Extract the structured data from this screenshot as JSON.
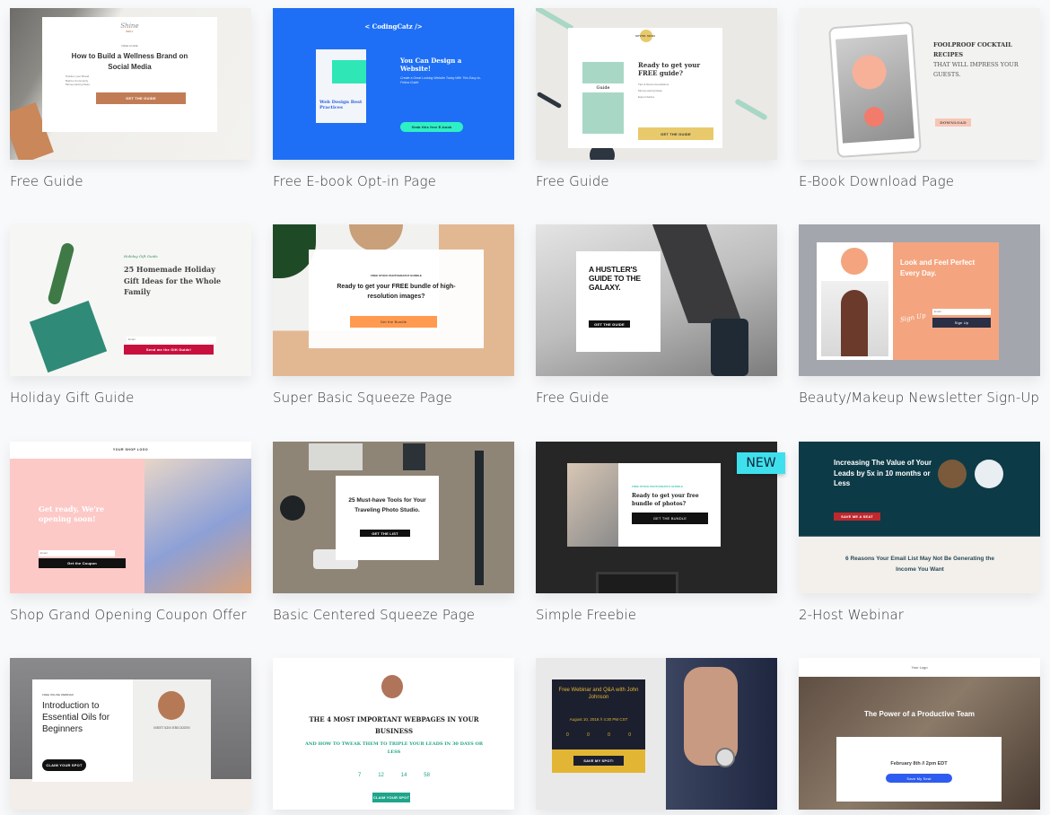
{
  "cards": [
    {
      "title": "Free Guide",
      "logo": "Shine",
      "logo2": "WELL",
      "kicker": "FREE GUIDE",
      "heading": "How to Build a Wellness Brand on Social Media",
      "bullets": [
        "Position your Brand",
        "Build a Community",
        "Money-saving Ideas"
      ],
      "button": "GET THE GUIDE"
    },
    {
      "title": "Free E-book Opt-in Page",
      "brand": "< CodingCatz />",
      "book": "Web Design Best Practices",
      "heading": "You Can Design a Website!",
      "sub": "Create a Great Looking Website Today With This Easy-to-Follow Guide",
      "button": "Grab this free E-book",
      "color": "#1e6ff5"
    },
    {
      "title": "Free Guide",
      "logo": "seven suns",
      "book": "Guide",
      "heading": "Ready to get your FREE guide?",
      "bullets": [
        "Tips & Recommendations",
        "Money-saving Ideas",
        "Expert Advice"
      ],
      "button": "GET THE GUIDE"
    },
    {
      "title": "E-Book Download Page",
      "heading": "FOOLPROOF COCKTAIL RECIPES",
      "heading2": "THAT WILL IMPRESS YOUR GUESTS.",
      "button": "DOWNLOAD"
    },
    {
      "title": "Holiday Gift Guide",
      "kicker": "Holiday Gift Guide",
      "heading": "25 Homemade Holiday Gift Ideas for the Whole Family",
      "input": "Email",
      "button": "Send me the Gift Guide!"
    },
    {
      "title": "Super Basic Squeeze Page",
      "kicker": "FREE STOCK PHOTOGRAPHY BUNDLE",
      "heading": "Ready to get your FREE bundle of high-resolution images?",
      "button": "Get the Bundle"
    },
    {
      "title": "Free Guide",
      "heading": "A HUSTLER'S GUIDE TO THE GALAXY.",
      "button": "GET THE GUIDE"
    },
    {
      "title": "Beauty/Makeup Newsletter Sign-Up",
      "heading": "Look and Feel Perfect Every Day.",
      "script": "Sign Up",
      "input": "Email",
      "button": "Sign Up"
    },
    {
      "title": "Shop Grand Opening Coupon Offer",
      "logo": "YOUR SHOP LOGO",
      "heading": "Get ready, We're opening soon!",
      "input": "Email",
      "button": "Get the Coupon"
    },
    {
      "title": "Basic Centered Squeeze Page",
      "heading": "25 Must-have Tools for Your Traveling Photo Studio.",
      "button": "GET THE LIST"
    },
    {
      "title": "Simple Freebie",
      "badge": "NEW",
      "kicker": "FREE STOCK PHOTOGRAPHY BUNDLE",
      "heading": "Ready to get your free bundle of photos?",
      "button": "GET THE BUNDLE"
    },
    {
      "title": "2-Host Webinar",
      "heading": "Increasing The Value of Your Leads by 5x in 10 months or Less",
      "button": "SAVE ME A SEAT",
      "heading2": "6 Reasons Your Email List May Not Be Generating the Income You Want"
    },
    {
      "title": "",
      "kicker": "FREE ONLINE WEBINAR",
      "heading": "Introduction to Essential Oils for Beginners",
      "button": "CLAIM YOUR SPOT",
      "host": "MEET KIM ERICKSEN"
    },
    {
      "title": "",
      "heading": "THE 4 MOST IMPORTANT WEBPAGES IN YOUR BUSINESS",
      "heading2": "AND HOW TO TWEAK THEM TO TRIPLE YOUR LEADS IN 30 DAYS OR LESS",
      "countdown": [
        "7",
        "12",
        "14",
        "58"
      ],
      "button": "CLAIM YOUR SPOT"
    },
    {
      "title": "",
      "heading": "Free Webinar and Q&A with John Johnson",
      "date": "August 10, 2018 // 4:30 PM CST",
      "countdown": [
        "0",
        "0",
        "0",
        "0"
      ],
      "button": "SAVE MY SPOT!"
    },
    {
      "title": "",
      "logo": "Your Logo",
      "heading": "The Power of a Productive Team",
      "date": "February 8th // 2pm EDT",
      "button": "Save My Seat"
    }
  ]
}
